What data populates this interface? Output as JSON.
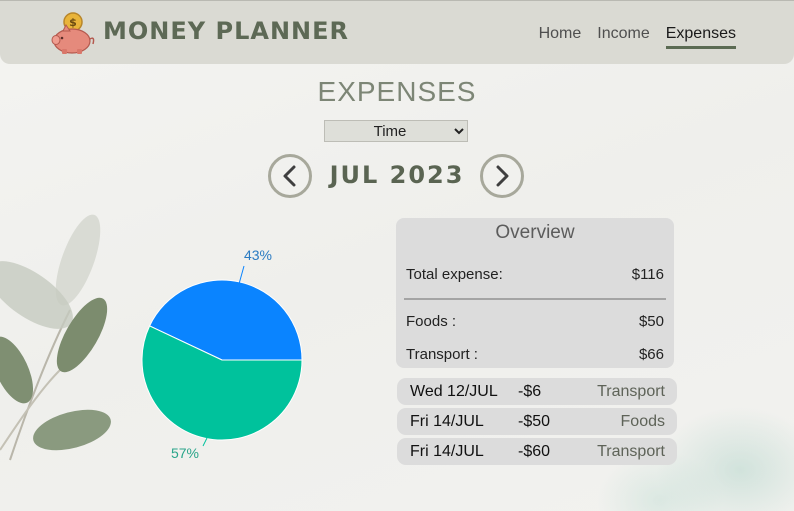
{
  "header": {
    "brand": "MONEY PLANNER",
    "logo_icon": "piggy-bank-icon",
    "nav": [
      {
        "label": "Home",
        "active": false
      },
      {
        "label": "Income",
        "active": false
      },
      {
        "label": "Expenses",
        "active": true
      }
    ]
  },
  "page": {
    "title": "EXPENSES",
    "filter": {
      "selected": "Time",
      "options": [
        "Time"
      ]
    },
    "month_label": "JUL 2023",
    "prev_icon": "chevron-left-icon",
    "next_icon": "chevron-right-icon"
  },
  "chart_data": {
    "type": "pie",
    "slices": [
      {
        "label": "43%",
        "value": 43,
        "color": "#0a84ff"
      },
      {
        "label": "57%",
        "value": 57,
        "color": "#00c29c"
      }
    ]
  },
  "overview": {
    "title": "Overview",
    "total_label": "Total expense:",
    "total_value": "$116",
    "rows": [
      {
        "label": "Foods :",
        "value": "$50"
      },
      {
        "label": "Transport :",
        "value": "$66"
      }
    ]
  },
  "transactions": [
    {
      "date": "Wed 12/JUL",
      "amount": "-$6",
      "category": "Transport"
    },
    {
      "date": "Fri 14/JUL",
      "amount": "-$50",
      "category": "Foods"
    },
    {
      "date": "Fri 14/JUL",
      "amount": "-$60",
      "category": "Transport"
    }
  ],
  "colors": {
    "header_bg": "#dadad3",
    "brand": "#5d6955",
    "accent_underline": "#5b6b53",
    "card_bg": "#dcdcdc"
  }
}
